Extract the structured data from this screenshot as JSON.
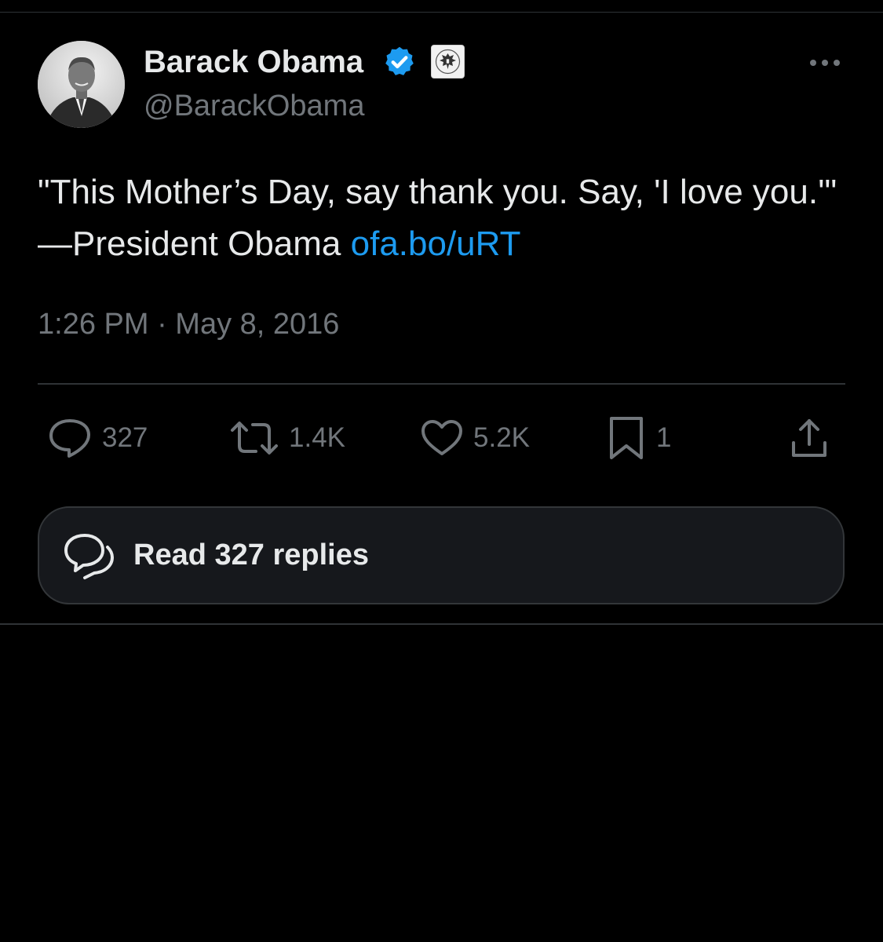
{
  "author": {
    "display_name": "Barack Obama",
    "handle": "@BarackObama",
    "verified_icon": "verified-badge-icon",
    "affiliate_icon": "government-seal-icon"
  },
  "tweet": {
    "text": "\"This Mother’s Day, say thank you. Say, 'I love you.'\" —President Obama ",
    "link_text": "ofa.bo/uRT",
    "timestamp": "1:26 PM · May 8, 2016"
  },
  "actions": {
    "replies": "327",
    "retweets": "1.4K",
    "likes": "5.2K",
    "bookmarks": "1"
  },
  "replies_button": {
    "label": "Read 327 replies"
  },
  "colors": {
    "background": "#000000",
    "text": "#e7e9ea",
    "muted": "#71767b",
    "link": "#1d9bf0",
    "verified": "#1d9bf0"
  }
}
